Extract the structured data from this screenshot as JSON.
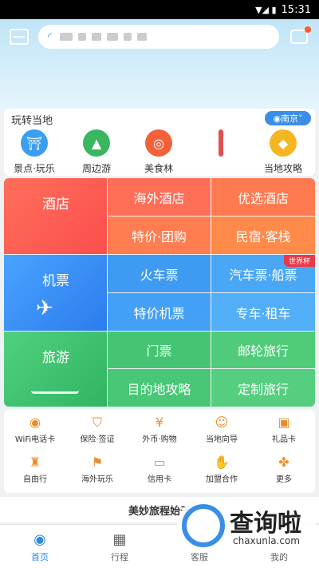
{
  "status": {
    "time": "15:31"
  },
  "local": {
    "title": "玩转当地",
    "city": "南京",
    "items": [
      {
        "label": "景点·玩乐",
        "icon": "temple-icon",
        "color": "#3a9ff0"
      },
      {
        "label": "周边游",
        "icon": "mountain-icon",
        "color": "#38b760"
      },
      {
        "label": "美食林",
        "icon": "food-icon",
        "color": "#f2613a"
      },
      {
        "label": "",
        "icon": "partial-icon",
        "color": "#e05050"
      },
      {
        "label": "当地攻略",
        "icon": "guide-icon",
        "color": "#f5b623"
      }
    ]
  },
  "grid": {
    "hotel": {
      "main": "酒店",
      "a": "海外酒店",
      "b": "优选酒店",
      "c": "特价·团购",
      "d": "民宿·客栈"
    },
    "flight": {
      "main": "机票",
      "a": "火车票",
      "b": "汽车票·船票",
      "c": "特价机票",
      "d": "专车·租车",
      "badge": "世界杯"
    },
    "travel": {
      "main": "旅游",
      "a": "门票",
      "b": "邮轮旅行",
      "c": "目的地攻略",
      "d": "定制旅行"
    }
  },
  "services": [
    {
      "label": "WiFi电话卡",
      "icon": "wifi-icon",
      "glyph": "◉"
    },
    {
      "label": "保险·签证",
      "icon": "shield-icon",
      "glyph": "⛉"
    },
    {
      "label": "外币·购物",
      "icon": "currency-icon",
      "glyph": "¥"
    },
    {
      "label": "当地向导",
      "icon": "guide-hat-icon",
      "glyph": "☺"
    },
    {
      "label": "礼品卡",
      "icon": "gift-card-icon",
      "glyph": "▣"
    },
    {
      "label": "自由行",
      "icon": "luggage-icon",
      "glyph": "♜"
    },
    {
      "label": "海外玩乐",
      "icon": "play-icon",
      "glyph": "⚑"
    },
    {
      "label": "信用卡",
      "icon": "credit-card-icon",
      "glyph": "▭"
    },
    {
      "label": "加盟合作",
      "icon": "handshake-icon",
      "glyph": "✋"
    },
    {
      "label": "更多",
      "icon": "more-icon",
      "glyph": "✤"
    }
  ],
  "slogan": "美妙旅程始于",
  "tabs": [
    {
      "label": "首页",
      "icon": "home-icon"
    },
    {
      "label": "行程",
      "icon": "calendar-icon"
    },
    {
      "label": "",
      "icon": "center-icon"
    },
    {
      "label": "客服",
      "icon": "service-icon"
    },
    {
      "label": "我的",
      "icon": "user-icon"
    }
  ],
  "watermark": {
    "title": "查询啦",
    "url": "chaxunla.com"
  }
}
